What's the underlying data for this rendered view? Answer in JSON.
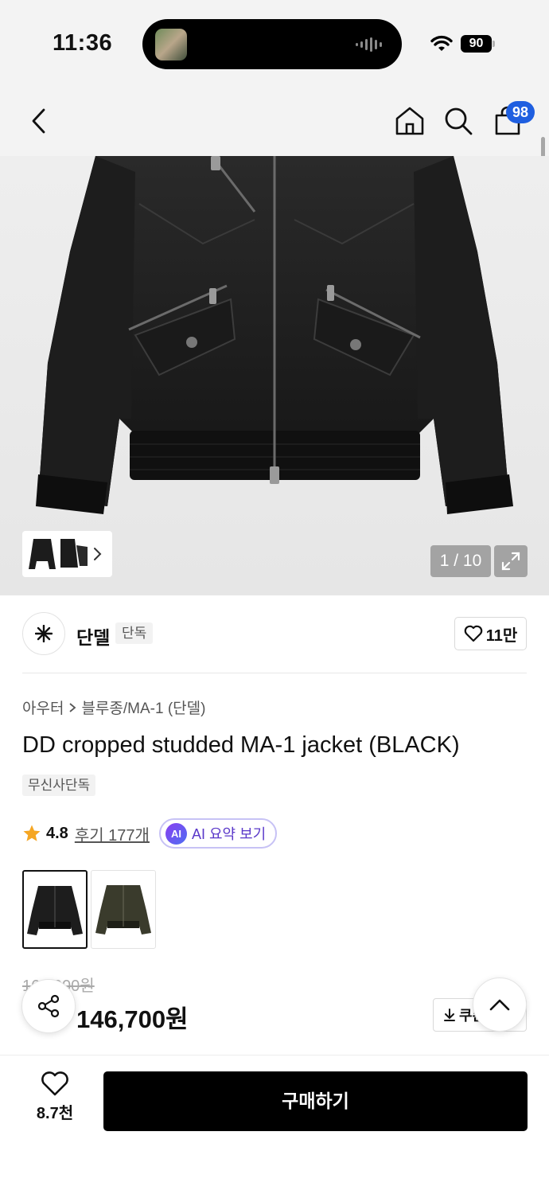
{
  "status_bar": {
    "time": "11:36",
    "battery": "90"
  },
  "header": {
    "cart_count": "98"
  },
  "gallery": {
    "counter": "1 / 10"
  },
  "brand": {
    "name": "단델",
    "tag": "단독",
    "likes": "11만"
  },
  "product": {
    "breadcrumb": [
      "아우터",
      "블루종/MA-1 (단델)"
    ],
    "title": "DD cropped studded MA-1 jacket (BLACK)",
    "exclusive_tag": "무신사단독",
    "rating": "4.8",
    "review_link": "후기 177개",
    "ai_circle": "AI",
    "ai_button": "AI 요약 보기",
    "color_options": [
      "black",
      "khaki"
    ],
    "original_price": "168,000원",
    "sale_price": "146,700원",
    "coupon_label": "쿠폰"
  },
  "bottom_bar": {
    "wish_count": "8.7천",
    "buy_label": "구매하기"
  },
  "colors": {
    "accent_blue": "#1f5fe0",
    "ai_purple": "#5a38c9",
    "star": "#f5a623",
    "button_black": "#000000"
  }
}
